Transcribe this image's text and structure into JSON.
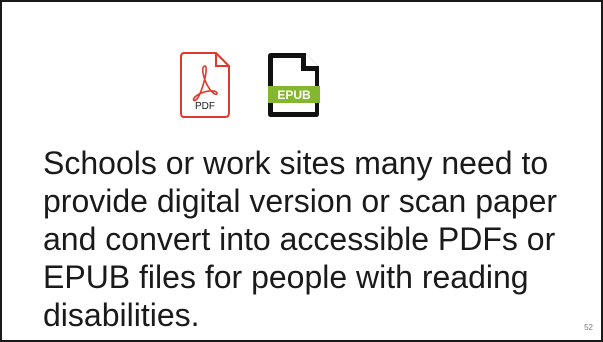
{
  "slide": {
    "icons": {
      "pdf": {
        "icon": "pdf-file-icon",
        "label": "PDF",
        "color": "#e0392b"
      },
      "epub": {
        "icon": "epub-file-icon",
        "label": "EPUB",
        "color": "#85b630"
      }
    },
    "body_text": "Schools or work sites many need to provide digital version or scan paper and convert into accessible PDFs or EPUB files for people with reading disabilities.",
    "slide_number": "52"
  }
}
